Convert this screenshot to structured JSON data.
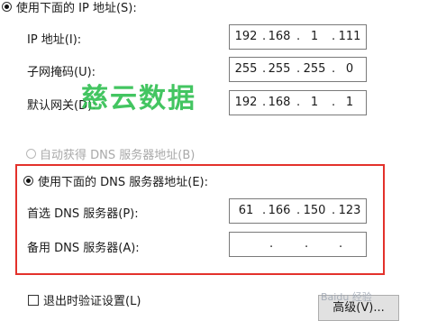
{
  "ip_section": {
    "radio_label": "使用下面的 IP 地址(S):",
    "ip_label": "IP 地址(I):",
    "ip_octets": [
      "192",
      "168",
      "1",
      "111"
    ],
    "mask_label": "子网掩码(U):",
    "mask_octets": [
      "255",
      "255",
      "255",
      "0"
    ],
    "gateway_label": "默认网关(D):",
    "gateway_octets": [
      "192",
      "168",
      "1",
      "1"
    ]
  },
  "dns_section": {
    "auto_radio_label": "自动获得 DNS 服务器地址(B)",
    "manual_radio_label": "使用下面的 DNS 服务器地址(E):",
    "preferred_label": "首选 DNS 服务器(P):",
    "preferred_octets": [
      "61",
      "166",
      "150",
      "123"
    ],
    "alternate_label": "备用 DNS 服务器(A):",
    "alternate_octets": [
      "",
      "",
      "",
      ""
    ]
  },
  "footer": {
    "validate_label": "退出时验证设置(L)",
    "advanced_button": "高级(V)..."
  },
  "watermark": {
    "text": "慈云数据",
    "baidu": "Baidu 经验"
  },
  "colors": {
    "highlight_frame": "#e3312b",
    "watermark": "#2fbf50"
  }
}
